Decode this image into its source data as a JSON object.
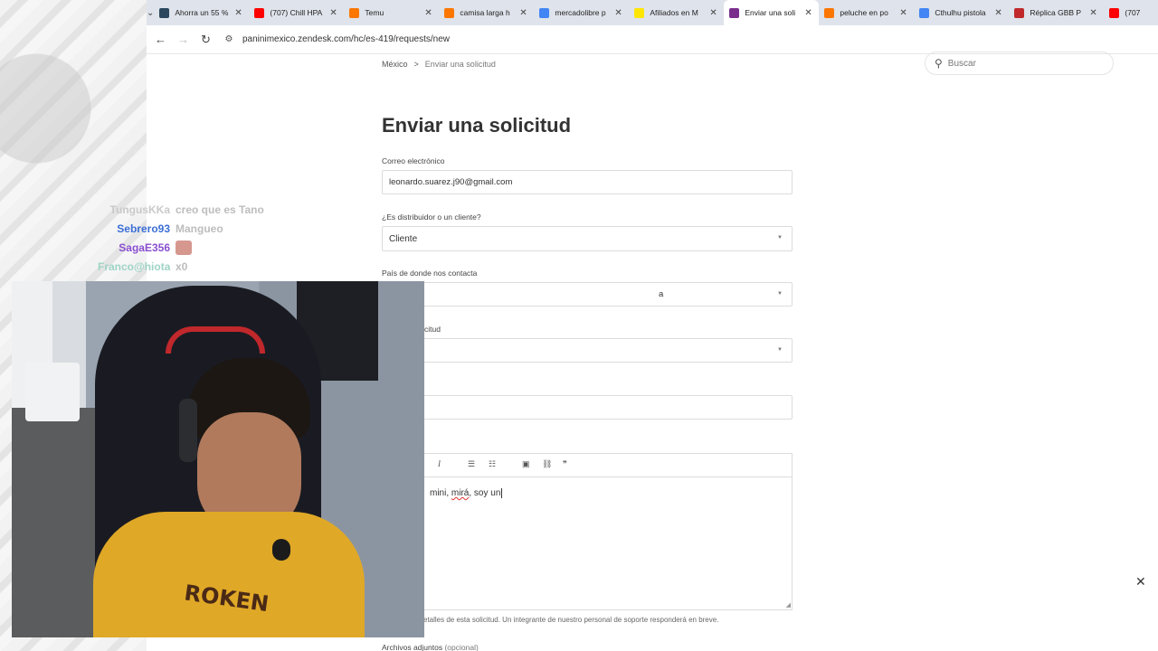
{
  "browser": {
    "tabs": [
      {
        "label": "Ahorra un 55 %",
        "favicon_color": "#2a475e",
        "icon": "steam-icon",
        "active": false
      },
      {
        "label": "(707) Chill HPA",
        "favicon_color": "#ff0000",
        "icon": "youtube-icon",
        "active": false
      },
      {
        "label": "Temu",
        "favicon_color": "#fb7701",
        "icon": "temu-icon",
        "active": false
      },
      {
        "label": "camisa larga h",
        "favicon_color": "#fb7701",
        "icon": "temu-icon",
        "active": false
      },
      {
        "label": "mercadolibre p",
        "favicon_color": "#4285f4",
        "icon": "google-icon",
        "active": false
      },
      {
        "label": "Afiliados en M",
        "favicon_color": "#ffe600",
        "icon": "mercadolibre-icon",
        "active": false
      },
      {
        "label": "Enviar una soli",
        "favicon_color": "#7a2e8c",
        "icon": "zendesk-icon",
        "active": true
      },
      {
        "label": "peluche en po",
        "favicon_color": "#fb7701",
        "icon": "temu-icon",
        "active": false
      },
      {
        "label": "Cthulhu pistola",
        "favicon_color": "#4285f4",
        "icon": "google-icon",
        "active": false
      },
      {
        "label": "Réplica GBB P",
        "favicon_color": "#c0282c",
        "icon": "flag-icon",
        "active": false
      },
      {
        "label": "(707",
        "favicon_color": "#ff0000",
        "icon": "youtube-icon",
        "active": false
      }
    ],
    "url": "paninimexico.zendesk.com/hc/es-419/requests/new"
  },
  "page": {
    "breadcrumb": {
      "home": "México",
      "separator": ">",
      "current": "Enviar una solicitud"
    },
    "search_placeholder": "Buscar",
    "title": "Enviar una solicitud",
    "email": {
      "label": "Correo electrónico",
      "value": "leonardo.suarez.j90@gmail.com"
    },
    "customer_type": {
      "label": "¿Es distribuidor o un cliente?",
      "value": "Cliente"
    },
    "country": {
      "label": "País de donde nos contacta",
      "value_visible": "a"
    },
    "request_type": {
      "label_visible": "citud"
    },
    "description": {
      "text_plain_1": "mini, ",
      "text_spell": "mirá",
      "text_plain_2": ", soy un"
    },
    "help_text": "etalles de esta solicitud. Un integrante de nuestro personal de soporte responderá en breve.",
    "attachments": {
      "label": "Archivos adjuntos",
      "optional": "(opcional)"
    }
  },
  "chat": [
    {
      "user": "TungusKKa",
      "user_color": "#c9c9c9",
      "message": "creo que es Tano"
    },
    {
      "user": "Sebrero93",
      "user_color": "#3b6fd6",
      "message": "Mangueo"
    },
    {
      "user": "SagaE356",
      "user_color": "#8a4fd0",
      "message": "",
      "emote": true
    },
    {
      "user": "Franco@hiota",
      "user_color": "#9fd4c4",
      "message": "x0"
    }
  ],
  "webcam": {
    "shirt_text": "ROKEN"
  }
}
